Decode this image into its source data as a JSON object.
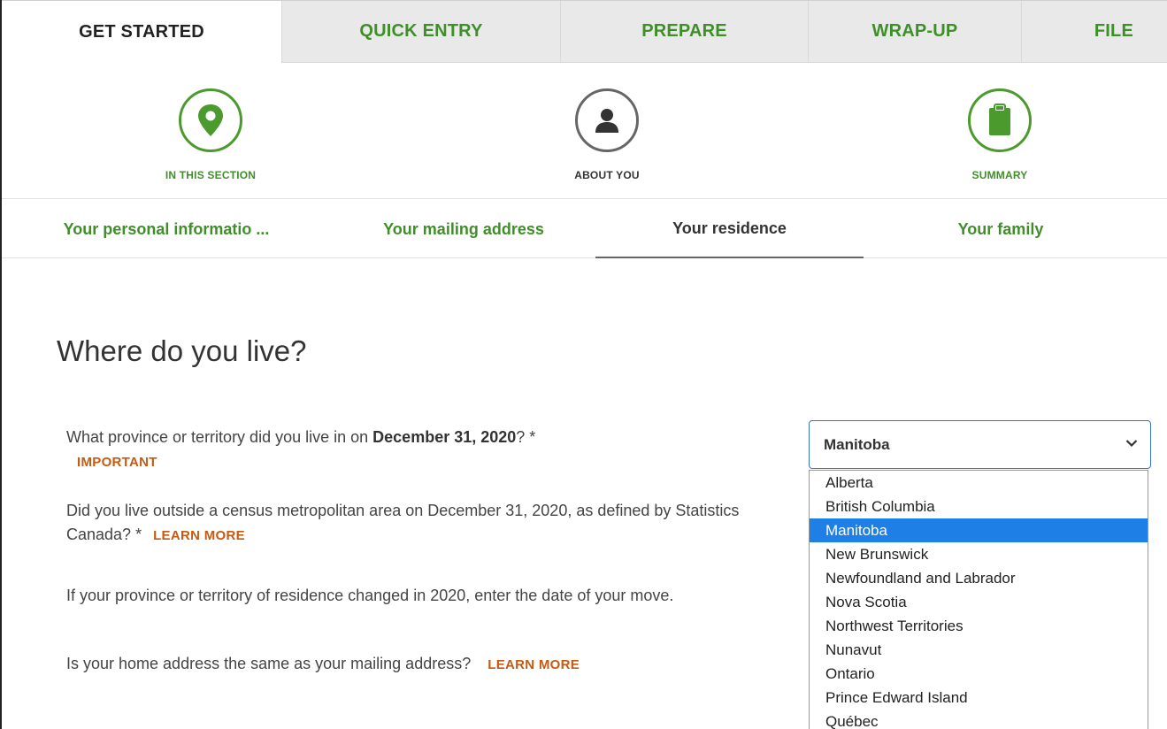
{
  "tabs": [
    {
      "label": "GET STARTED"
    },
    {
      "label": "QUICK ENTRY"
    },
    {
      "label": "PREPARE"
    },
    {
      "label": "WRAP-UP"
    },
    {
      "label": "FILE"
    }
  ],
  "steps": [
    {
      "label": "IN THIS SECTION",
      "icon": "map-pin-icon"
    },
    {
      "label": "ABOUT YOU",
      "icon": "person-icon"
    },
    {
      "label": "SUMMARY",
      "icon": "clipboard-icon"
    }
  ],
  "subnav": [
    {
      "label": "Your personal informatio ..."
    },
    {
      "label": "Your mailing address"
    },
    {
      "label": "Your residence"
    },
    {
      "label": "Your family"
    }
  ],
  "main": {
    "heading": "Where do you live?",
    "q1_prefix": "What province or territory did you live in on ",
    "q1_bold": "December 31, 2020",
    "q1_suffix": "? *",
    "q1_link": "IMPORTANT",
    "q2_text": "Did you live outside a census metropolitan area on December 31, 2020, as defined by Statistics Canada? *",
    "q2_link": "LEARN MORE",
    "q3_text": "If your province or territory of residence changed in 2020, enter the date of your move.",
    "q4_text": "Is your home address the same as your mailing address?",
    "q4_link": "LEARN MORE"
  },
  "province_select": {
    "value": "Manitoba",
    "options": [
      "Alberta",
      "British Columbia",
      "Manitoba",
      "New Brunswick",
      "Newfoundland and Labrador",
      "Nova Scotia",
      "Northwest Territories",
      "Nunavut",
      "Ontario",
      "Prince Edward Island",
      "Québec"
    ]
  },
  "colors": {
    "green": "#3f8f29",
    "link_orange": "#c65a11",
    "select_blue": "#1e7fe6"
  }
}
